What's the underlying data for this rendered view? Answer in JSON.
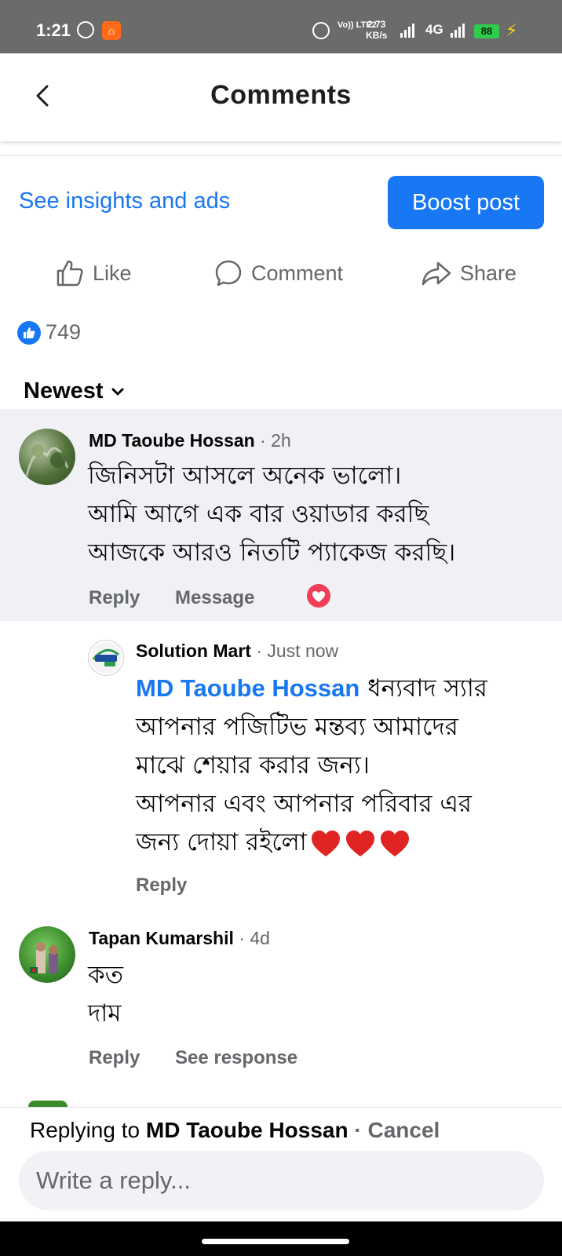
{
  "status_bar": {
    "time": "1:21",
    "volte": "Vo)) LTE2",
    "speed_value": "2.73",
    "speed_unit": "KB/s",
    "network": "4G",
    "battery": "88",
    "whatsapp_icon": "whatsapp-icon",
    "app_icon": "app-notification-icon"
  },
  "header": {
    "title": "Comments",
    "back_icon": "back-arrow-icon"
  },
  "insights": {
    "link_label": "See insights and ads",
    "boost_label": "Boost post",
    "boost_color": "#1877f2"
  },
  "actions": {
    "like_label": "Like",
    "comment_label": "Comment",
    "share_label": "Share"
  },
  "reactions": {
    "count": "749",
    "icon": "like-reaction-icon"
  },
  "sort": {
    "label": "Newest",
    "icon": "chevron-down-icon"
  },
  "comments": [
    {
      "author": "MD Taoube Hossan",
      "time": "· 2h",
      "lines": [
        "জিনিসটা আসলে অনেক ভালো।",
        "আমি আগে এক বার ওয়াডার করছি",
        "আজকে আরও নিতটি প্যাকেজ করছি।"
      ],
      "reply_label": "Reply",
      "message_label": "Message",
      "reaction_count": "1",
      "reaction_icon": "love-reaction-icon",
      "highlight_color": "#eff1f4"
    },
    {
      "author": "Solution Mart",
      "time": "· Just now",
      "mention": "MD Taoube Hossan",
      "line1_rest": "ধন্যবাদ স্যার",
      "lines": [
        "আপনার পজিটিভ মন্তব্য আমাদের",
        "মাঝে শেয়ার করার জন্য।",
        "আপনার এবং আপনার পরিবার এর",
        "জন্য দোয়া রইলো"
      ],
      "reply_label": "Reply",
      "avatar_text": "SOLUTION MART"
    },
    {
      "author": "Tapan Kumarshil",
      "time": "· 4d",
      "lines": [
        "কত",
        "দাম"
      ],
      "reply_label": "Reply",
      "response_label": "See response"
    }
  ],
  "composer": {
    "replying_prefix": "Replying to",
    "replying_name": "MD Taoube Hossan",
    "separator": "·",
    "cancel_label": "Cancel",
    "placeholder": "Write a reply..."
  }
}
